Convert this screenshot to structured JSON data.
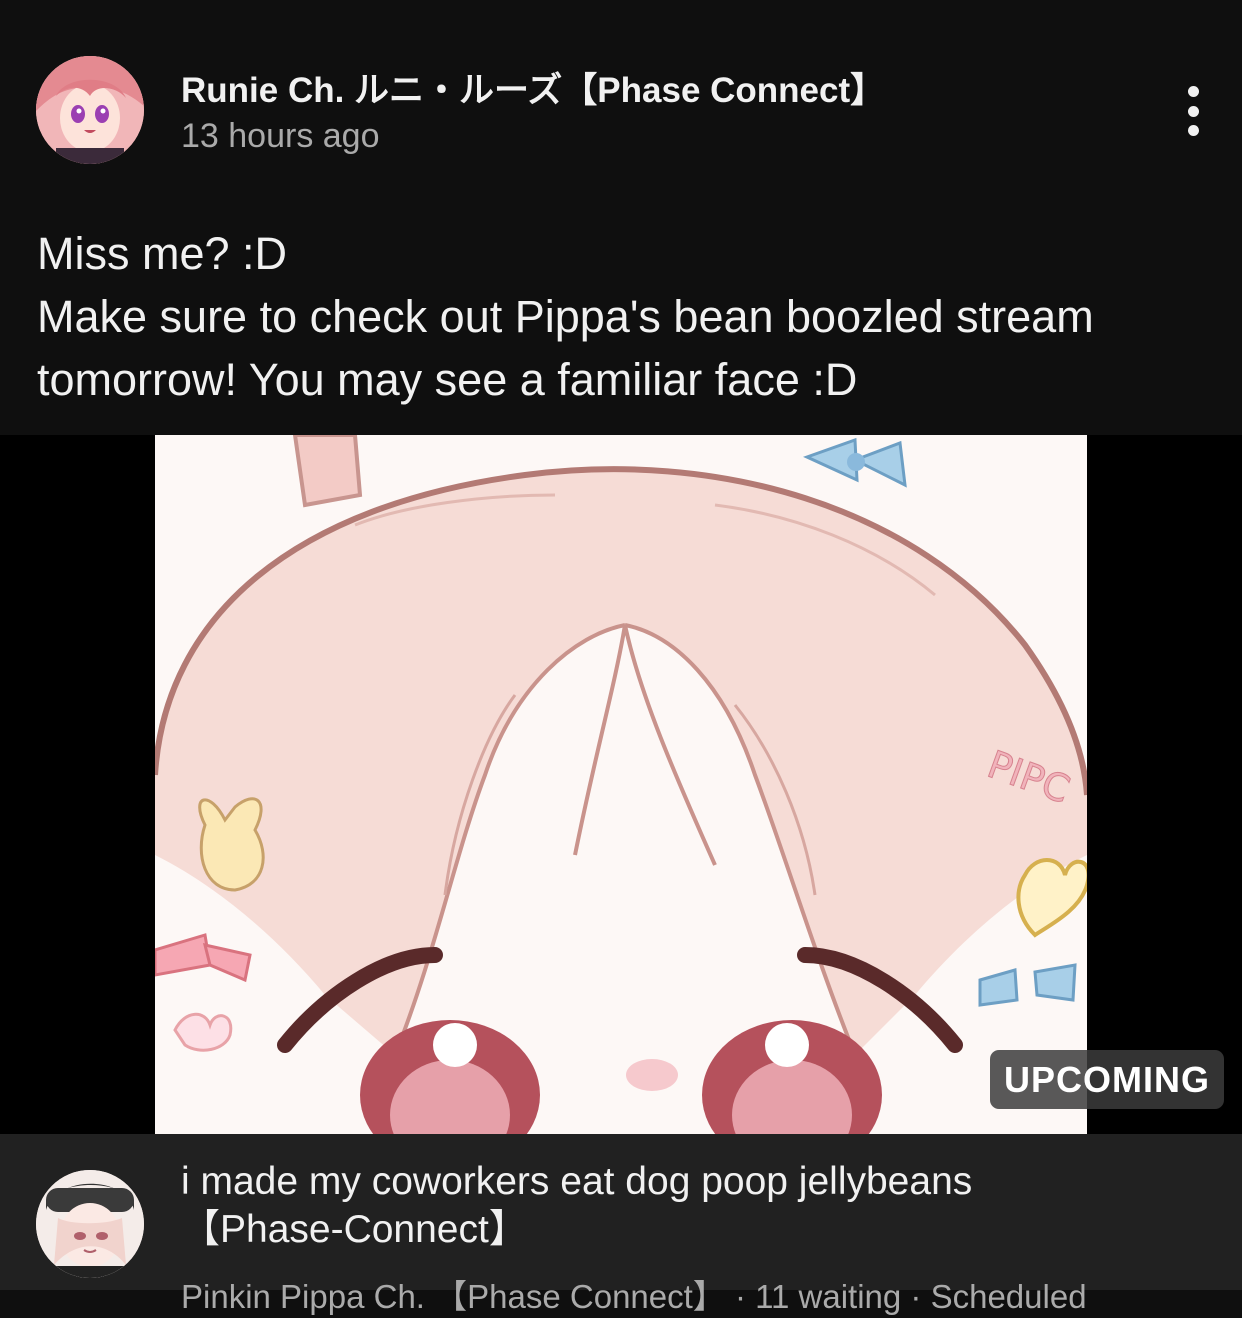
{
  "post": {
    "author": "Runie Ch. ルニ・ルーズ【Phase Connect】",
    "time": "13 hours ago",
    "text_lines": [
      "Miss me? :D",
      "Make sure to check out Pippa's bean boozled stream",
      "tomorrow! You may see a familiar face :D"
    ],
    "menu_icon": "more-vertical-icon",
    "art_text": "PIPC"
  },
  "video": {
    "badge": "UPCOMING",
    "title_lines": [
      "i made my coworkers eat dog poop jellybeans",
      "【Phase-Connect】"
    ],
    "meta": "Pinkin Pippa Ch. 【Phase Connect】 · 11 waiting · Scheduled"
  },
  "colors": {
    "background": "#0f0f0f",
    "card": "#212121",
    "text": "#f1f1f1",
    "secondary_text": "#aaaaaa",
    "hair_pink": "#f3d3cf",
    "accent_pink": "#e8a3a8"
  }
}
